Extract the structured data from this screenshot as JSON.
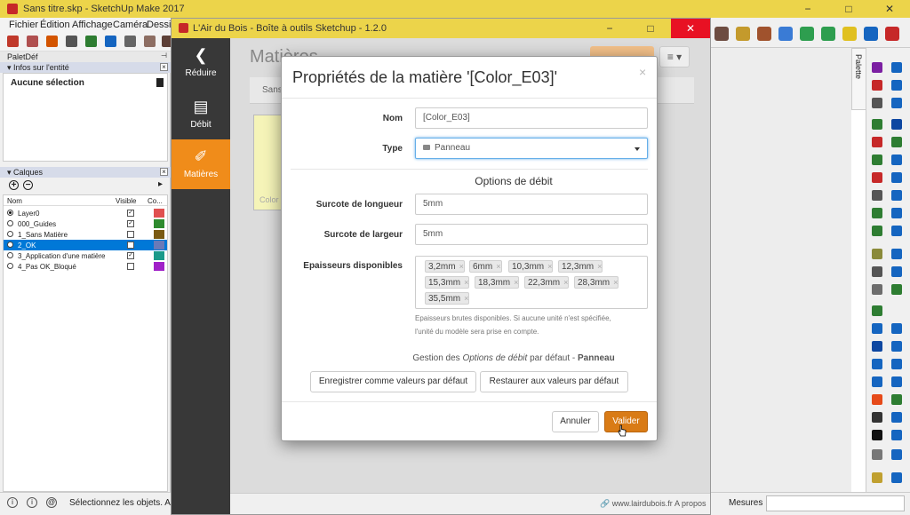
{
  "sketchup": {
    "title": "Sans titre.skp - SketchUp Make 2017",
    "window_controls": [
      "−",
      "□",
      "✕"
    ],
    "menu": [
      "Fichier",
      "Édition",
      "Affichage",
      "Caméra",
      "Dessin"
    ],
    "tray": {
      "title": "PaletDéf",
      "entity_panel_title": "Infos sur l'entité",
      "entity_selection": "Aucune sélection",
      "layers_panel_title": "Calques",
      "layers_columns": {
        "name": "Nom",
        "visible": "Visible",
        "color": "Co..."
      },
      "layers": [
        {
          "name": "Layer0",
          "active": true,
          "visible": true,
          "color": "#e05050",
          "selected": false
        },
        {
          "name": "000_Guides",
          "active": false,
          "visible": true,
          "color": "#2e8b2e",
          "selected": false
        },
        {
          "name": "1_Sans Matière",
          "active": false,
          "visible": false,
          "color": "#7a5a12",
          "selected": false
        },
        {
          "name": "2_OK",
          "active": false,
          "visible": false,
          "color": "#6a7ab8",
          "selected": true
        },
        {
          "name": "3_Application d'une matière",
          "active": false,
          "visible": true,
          "color": "#1a9a8a",
          "selected": false
        },
        {
          "name": "4_Pas OK_Bloqué",
          "active": false,
          "visible": false,
          "color": "#a020c8",
          "selected": false
        }
      ]
    },
    "status": {
      "text": "Sélectionnez les objets. Ap",
      "measures_label": "Mesures",
      "icons": [
        "i",
        "i",
        "@"
      ]
    },
    "palette_tab": "Palette"
  },
  "plugin": {
    "title": "L'Air du Bois - Boîte à outils Sketchup - 1.2.0",
    "window_controls": [
      "−",
      "□",
      "✕"
    ],
    "nav": [
      {
        "label": "Réduire",
        "icon": "chevron-left-icon",
        "glyph": "❮",
        "active": false
      },
      {
        "label": "Débit",
        "icon": "list-icon",
        "glyph": "▤",
        "active": false
      },
      {
        "label": "Matières",
        "icon": "materials-icon",
        "glyph": "✐",
        "active": true
      }
    ],
    "page_title": "Matières",
    "tab_label": "Sans",
    "card_label": "Color",
    "menu_glyph": "≡ ▾",
    "footer_link": "www.lairdubois.fr",
    "footer_about": "A propos",
    "colors": {
      "accent": "#f08c1a",
      "sidebar": "#383838",
      "primary_button": "#d97b16"
    }
  },
  "modal": {
    "title": "Propriétés de la matière '[Color_E03]'",
    "close": "×",
    "name_label": "Nom",
    "name_value": "[Color_E03]",
    "type_label": "Type",
    "type_value": "Panneau",
    "section_title": "Options de débit",
    "length_label": "Surcote de longueur",
    "length_value": "5mm",
    "width_label": "Surcote de largeur",
    "width_value": "5mm",
    "thickness_label": "Epaisseurs disponibles",
    "thicknesses": [
      "3,2mm",
      "6mm",
      "10,3mm",
      "12,3mm",
      "15,3mm",
      "18,3mm",
      "22,3mm",
      "28,3mm",
      "35,5mm"
    ],
    "help_line1": "Epaisseurs brutes disponibles. Si aucune unité n'est spécifiée,",
    "help_line2": "l'unité du modèle sera prise en compte.",
    "gestion_prefix": "Gestion des ",
    "gestion_em": "Options de débit",
    "gestion_mid": " par défaut - ",
    "gestion_bold": "Panneau",
    "save_defaults": "Enregistrer comme valeurs par défaut",
    "restore_defaults": "Restaurer aux valeurs par défaut",
    "cancel": "Annuler",
    "validate": "Valider"
  }
}
